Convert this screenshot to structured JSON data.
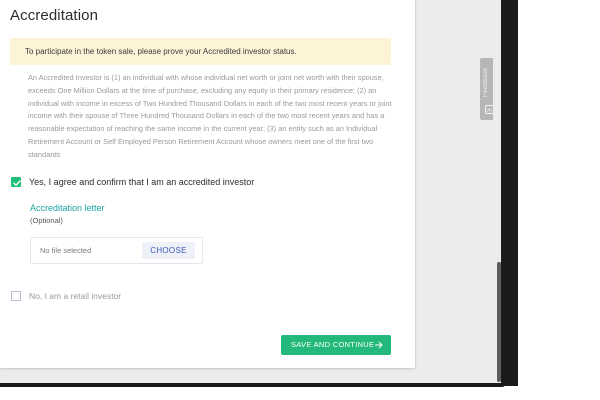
{
  "page": {
    "title": "Accreditation",
    "notice": "To participate in the token sale, please prove your Accredited investor status.",
    "definition": "An Accredited Investor is (1) an individual with whose individual net worth or joint net worth with their spouse, exceeds One Million Dollars at the time of purchase, excluding any equity in their primary residence; (2) an individual with income in excess of Two Hundred Thousand Dollars in each of the two most recent years or joint income with their spouse of Three Hundred Thousand Dollars in each of the two most recent years and has a reasonable expectation of reaching the same income in the current year; (3) an entity such as an Individual Retirement Account or Self Employed Person Retirement Account whose owners meet one of the first two standards"
  },
  "options": {
    "accredited_label": "Yes, I agree and confirm that I am an accredited investor",
    "accredited_checked": true,
    "retail_label": "No, I am a retail investor",
    "retail_checked": false
  },
  "upload": {
    "title": "Accreditation letter",
    "optional": "(Optional)",
    "file_status": "No file selected",
    "choose_label": "CHOOSE"
  },
  "actions": {
    "save_label": "SAVE AND CONTINUE",
    "save_icon": "arrow-right-icon"
  },
  "feedback": {
    "label": "Feedback",
    "icon": "feedback-icon"
  },
  "colors": {
    "accent_green": "#23b97b",
    "link_teal": "#1aa3a0",
    "notice_bg": "#fdf3d7",
    "choose_text": "#3b5bb5"
  }
}
